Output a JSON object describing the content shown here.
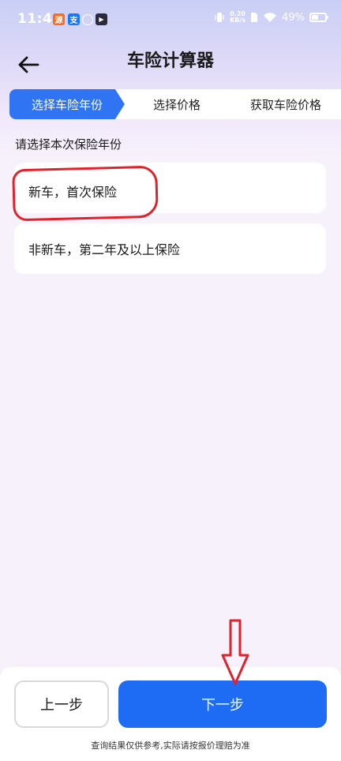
{
  "status_bar": {
    "time": "11:46",
    "notifications": [
      {
        "icon": "app-red-icon",
        "glyph": "源",
        "color": "#ff6a1a"
      },
      {
        "icon": "alipay-icon",
        "glyph": "支",
        "color": "#1677ff"
      },
      {
        "icon": "browser-icon",
        "glyph": "◯",
        "color": "#ffffff"
      },
      {
        "icon": "video-app-icon",
        "glyph": "▶",
        "color": "#2a2a3a"
      }
    ],
    "net_speed_value": "0.20",
    "net_speed_unit": "KB/s",
    "battery_percent": "49%",
    "battery_level": 0.49
  },
  "header": {
    "back_icon": "arrow-left-icon",
    "title": "车险计算器"
  },
  "steps": [
    {
      "label": "选择车险年份",
      "active": true
    },
    {
      "label": "选择价格",
      "active": false
    },
    {
      "label": "获取车险价格",
      "active": false
    }
  ],
  "main": {
    "prompt": "请选择本次保险年份",
    "options": [
      {
        "label": "新车，首次保险"
      },
      {
        "label": "非新车，第二年及以上保险"
      }
    ]
  },
  "footer": {
    "prev_label": "上一步",
    "next_label": "下一步",
    "disclaimer": "查询结果仅供参考,实际请按报价理赔为准"
  },
  "colors": {
    "accent": "#1e6cf3",
    "annotation": "#e0232b"
  }
}
